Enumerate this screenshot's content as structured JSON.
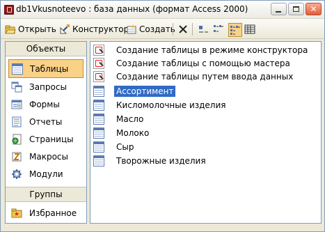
{
  "window": {
    "title": "db1Vkusnoteevo : база данных (формат Access 2000)"
  },
  "toolbar": {
    "open_label": "Открыть",
    "design_label": "Конструктор",
    "new_label": "Создать"
  },
  "sidebar": {
    "header": "Объекты",
    "items": [
      {
        "label": "Таблицы",
        "icon": "table-icon",
        "selected": true
      },
      {
        "label": "Запросы",
        "icon": "query-icon"
      },
      {
        "label": "Формы",
        "icon": "form-icon"
      },
      {
        "label": "Отчеты",
        "icon": "report-icon"
      },
      {
        "label": "Страницы",
        "icon": "page-icon"
      },
      {
        "label": "Макросы",
        "icon": "macro-icon"
      },
      {
        "label": "Модули",
        "icon": "module-icon"
      }
    ],
    "groups_header": "Группы",
    "groups": [
      {
        "label": "Избранное",
        "icon": "favorites-icon"
      }
    ]
  },
  "list": {
    "items": [
      {
        "label": "Создание таблицы в режиме конструктора",
        "icon": "wizard-icon"
      },
      {
        "label": "Создание таблицы с помощью мастера",
        "icon": "wizard-icon"
      },
      {
        "label": "Создание таблицы путем ввода данных",
        "icon": "wizard-icon"
      },
      {
        "label": "Ассортимент",
        "icon": "table-icon",
        "selected": true
      },
      {
        "label": "Кисломолочные изделия",
        "icon": "table-icon"
      },
      {
        "label": "Масло",
        "icon": "table-icon"
      },
      {
        "label": "Молоко",
        "icon": "table-icon"
      },
      {
        "label": "Сыр",
        "icon": "table-icon"
      },
      {
        "label": "Творожные изделия",
        "icon": "table-icon"
      }
    ]
  },
  "colors": {
    "selection": "#316ac5",
    "sidebar_selected": "#f9d187",
    "border": "#7f9db9"
  }
}
